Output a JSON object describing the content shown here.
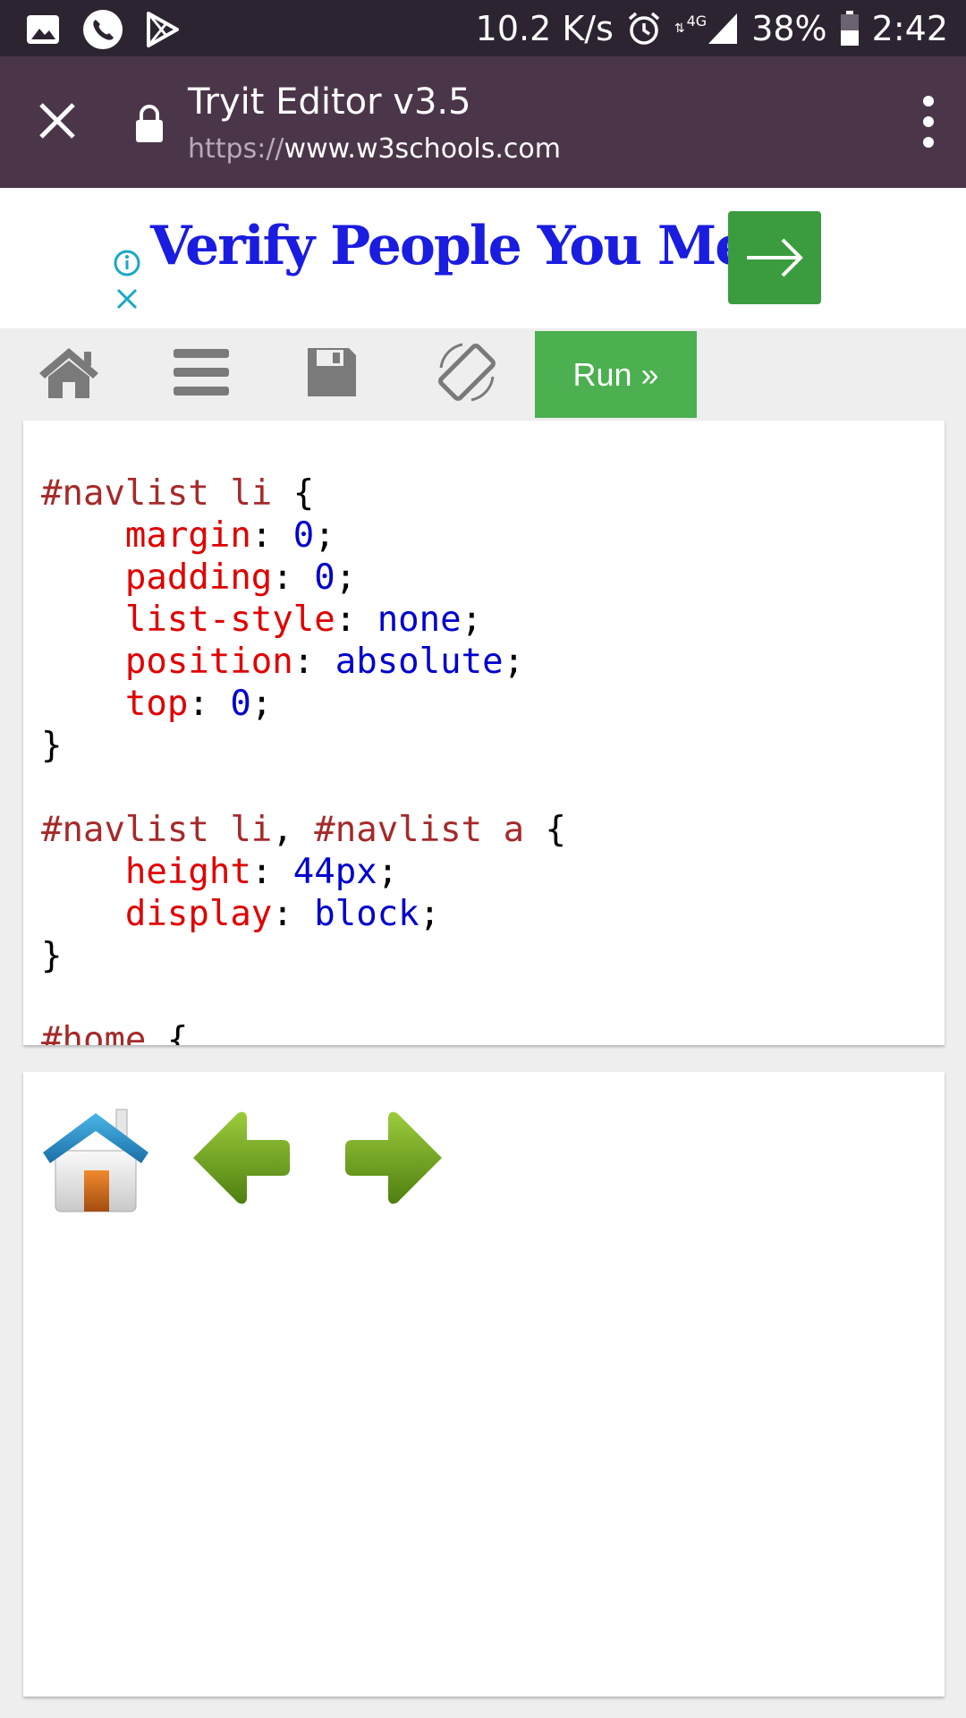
{
  "status_bar": {
    "net_speed": "10.2 K/s",
    "network": "4G",
    "battery": "38%",
    "time": "2:42"
  },
  "browser": {
    "title": "Tryit Editor v3.5",
    "url_scheme": "https://",
    "url_host": "www.w3schools.com"
  },
  "ad": {
    "text": "Verify People You Meet"
  },
  "toolbar": {
    "run_label": "Run »"
  },
  "code_lines": [
    "#navlist li {",
    "margin: 0;",
    "padding: 0;",
    "list-style: none;",
    "position: absolute;",
    "top: 0;",
    "#navlist li, #navlist a {",
    "height: 44px;",
    "display: block;",
    "#home {"
  ],
  "code": {
    "rule1": {
      "sel": "#navlist li",
      "decls": [
        {
          "p": "margin",
          "v": "0"
        },
        {
          "p": "padding",
          "v": "0"
        },
        {
          "p": "list-style",
          "v": "none"
        },
        {
          "p": "position",
          "v": "absolute"
        },
        {
          "p": "top",
          "v": "0"
        }
      ]
    },
    "rule2": {
      "sel_a": "#navlist li",
      "sel_b": "#navlist a",
      "decls": [
        {
          "p": "height",
          "v": "44px"
        },
        {
          "p": "display",
          "v": "block"
        }
      ]
    },
    "rule3": {
      "sel": "#home"
    }
  },
  "colors": {
    "status_bar": "#2d2431",
    "browser_bar": "#4b3649",
    "run_button": "#4caf50",
    "ad_text": "#1a1ce0",
    "selector": "#a52a2a",
    "property": "#e00000",
    "value": "#0000cd"
  },
  "icons": [
    "gallery-icon",
    "phone-icon",
    "play-store-icon",
    "alarm-icon",
    "signal-icon",
    "battery-icon",
    "close-icon",
    "lock-icon",
    "more-vert-icon",
    "info-icon",
    "ad-close-icon",
    "arrow-right-icon",
    "home-icon",
    "menu-icon",
    "save-icon",
    "rotate-icon",
    "house-icon",
    "left-arrow-icon",
    "right-arrow-icon"
  ]
}
